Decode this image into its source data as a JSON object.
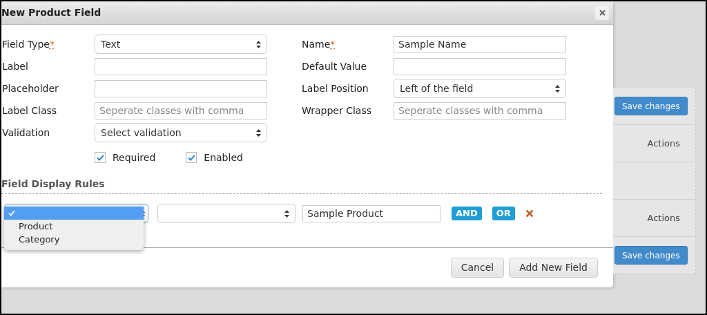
{
  "dialog": {
    "title": "New Product Field",
    "left_fields": [
      {
        "label": "Field Type",
        "required_mark": "*",
        "kind": "select",
        "value": "Text"
      },
      {
        "label": "Label",
        "kind": "text"
      },
      {
        "label": "Placeholder",
        "kind": "text"
      },
      {
        "label": "Label Class",
        "kind": "text",
        "placeholder": "Seperate classes with comma"
      },
      {
        "label": "Validation",
        "kind": "select",
        "value": "Select validation"
      }
    ],
    "right_fields": [
      {
        "label": "Name",
        "required_mark": "*",
        "kind": "text",
        "value": "Sample Name"
      },
      {
        "label": "Default Value",
        "kind": "text"
      },
      {
        "label": "Label Position",
        "kind": "select",
        "value": "Left of the field"
      },
      {
        "label": "Wrapper Class",
        "kind": "text",
        "placeholder": "Seperate classes with comma"
      }
    ],
    "checkboxes": [
      {
        "label": "Required",
        "checked": true
      },
      {
        "label": "Enabled",
        "checked": true
      }
    ],
    "display_rules": {
      "heading": "Field Display Rules",
      "condition_options": [
        {
          "selected": true
        },
        {
          "label": "Product",
          "selected": false
        },
        {
          "label": "Category",
          "selected": false
        }
      ],
      "value": "Sample Product",
      "buttons": [
        "AND",
        "OR"
      ]
    },
    "footer_buttons": [
      "Cancel",
      "Add New Field"
    ]
  },
  "background": {
    "rows": [
      {
        "kind": "button",
        "label": "Save changes"
      },
      {
        "kind": "text",
        "label": "Actions"
      },
      {
        "kind": "blank"
      },
      {
        "kind": "text",
        "label": "Actions"
      },
      {
        "kind": "button",
        "label": "Save changes"
      }
    ]
  }
}
